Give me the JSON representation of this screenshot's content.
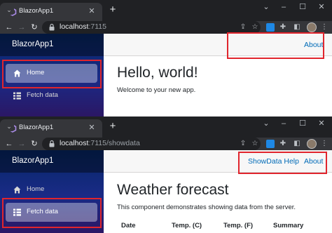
{
  "screens": [
    {
      "tab_title": "BlazorApp1",
      "url_host": "localhost",
      "url_rest": ":7115",
      "brand": "BlazorApp1",
      "nav": [
        {
          "label": "Home",
          "icon": "home-icon",
          "active": true
        },
        {
          "label": "Fetch data",
          "icon": "list-icon",
          "active": false
        }
      ],
      "top_links": [
        "About"
      ],
      "heading": "Hello, world!",
      "body_text": "Welcome to your new app."
    },
    {
      "tab_title": "BlazorApp1",
      "url_host": "localhost",
      "url_rest": ":7115/showdata",
      "brand": "BlazorApp1",
      "nav": [
        {
          "label": "Home",
          "icon": "home-icon",
          "active": false
        },
        {
          "label": "Fetch data",
          "icon": "list-icon",
          "active": true
        }
      ],
      "top_links": [
        "ShowData Help",
        "About"
      ],
      "heading": "Weather forecast",
      "body_text": "This component demonstrates showing data from the server.",
      "table_headers": [
        "Date",
        "Temp. (C)",
        "Temp. (F)",
        "Summary"
      ]
    }
  ],
  "colors": {
    "browser_frame": "#202124",
    "browser_toolbar": "#35363a",
    "sidebar_top": "#052767",
    "sidebar_bottom": "#3a0647",
    "link": "#006bb7",
    "highlight": "#e0252d"
  }
}
